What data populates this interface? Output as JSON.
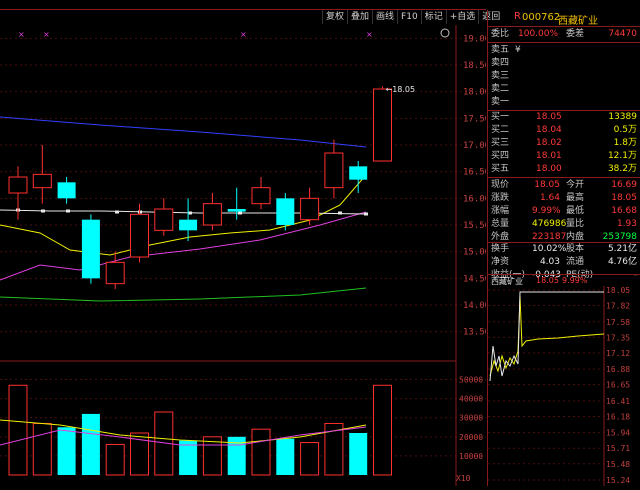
{
  "toolbar": {
    "items": [
      "复权",
      "叠加",
      "画线",
      "F10",
      "标记",
      "+自选",
      "返回"
    ]
  },
  "main_chart": {
    "price_ticks": [
      "18.00",
      "17.50",
      "17.00",
      "16.50",
      "16.00",
      "15.50",
      "15.00",
      "14.50",
      "14.00",
      "13.50",
      "18.50",
      "19.00"
    ],
    "last_price_label": "18.05",
    "volume_ticks": [
      "50000",
      "40000",
      "30000",
      "20000",
      "10000"
    ],
    "volume_unit": "X10",
    "colors": {
      "up": "#ff3030",
      "down": "#00ffff",
      "ma_white": "#e8e8e8",
      "ma_yellow": "#f0f000",
      "ma_purple": "#e040e0",
      "ma_green": "#20c020",
      "ma_blue": "#3040ff"
    },
    "candles": [
      {
        "o": 16.4,
        "c": 16.1,
        "h": 16.6,
        "l": 15.6,
        "up": true
      },
      {
        "o": 16.2,
        "c": 16.45,
        "h": 17.0,
        "l": 15.9,
        "up": true
      },
      {
        "o": 16.3,
        "c": 16.0,
        "h": 16.4,
        "l": 15.9,
        "up": false
      },
      {
        "o": 15.6,
        "c": 14.5,
        "h": 15.7,
        "l": 14.4,
        "up": false
      },
      {
        "o": 14.4,
        "c": 14.8,
        "h": 15.0,
        "l": 14.3,
        "up": true
      },
      {
        "o": 14.9,
        "c": 15.7,
        "h": 15.9,
        "l": 14.8,
        "up": true
      },
      {
        "o": 15.4,
        "c": 15.8,
        "h": 16.0,
        "l": 15.3,
        "up": true
      },
      {
        "o": 15.6,
        "c": 15.4,
        "h": 16.0,
        "l": 15.2,
        "up": false
      },
      {
        "o": 15.5,
        "c": 15.9,
        "h": 16.1,
        "l": 15.4,
        "up": true
      },
      {
        "o": 15.8,
        "c": 15.75,
        "h": 16.2,
        "l": 15.6,
        "up": false
      },
      {
        "o": 15.9,
        "c": 16.2,
        "h": 16.4,
        "l": 15.8,
        "up": true
      },
      {
        "o": 16.0,
        "c": 15.5,
        "h": 16.1,
        "l": 15.4,
        "up": false
      },
      {
        "o": 15.6,
        "c": 16.0,
        "h": 16.2,
        "l": 15.5,
        "up": true
      },
      {
        "o": 16.2,
        "c": 16.85,
        "h": 17.1,
        "l": 16.0,
        "up": true
      },
      {
        "o": 16.6,
        "c": 16.35,
        "h": 16.7,
        "l": 16.1,
        "up": false
      },
      {
        "o": 16.7,
        "c": 18.05,
        "h": 18.1,
        "l": 16.7,
        "up": true
      }
    ],
    "volumes": [
      {
        "v": 47000,
        "up": true
      },
      {
        "v": 27000,
        "up": true
      },
      {
        "v": 25000,
        "up": false
      },
      {
        "v": 32000,
        "up": false
      },
      {
        "v": 16000,
        "up": true
      },
      {
        "v": 22000,
        "up": true
      },
      {
        "v": 33000,
        "up": true
      },
      {
        "v": 18000,
        "up": false
      },
      {
        "v": 20000,
        "up": true
      },
      {
        "v": 20000,
        "up": false
      },
      {
        "v": 24000,
        "up": true
      },
      {
        "v": 19000,
        "up": false
      },
      {
        "v": 17000,
        "up": true
      },
      {
        "v": 27000,
        "up": true
      },
      {
        "v": 22000,
        "up": false
      },
      {
        "v": 47000,
        "up": true
      }
    ]
  },
  "panel": {
    "r_mark": "R",
    "code": "000762",
    "name": "西藏矿业",
    "weibi_label": "委比",
    "weibi_value": "100.00%",
    "weicha_label": "委差",
    "weicha_value": "74470",
    "asks": [
      {
        "label": "卖五",
        "suffix": "¥"
      },
      {
        "label": "卖四"
      },
      {
        "label": "卖三"
      },
      {
        "label": "卖二"
      },
      {
        "label": "卖一"
      }
    ],
    "bids": [
      {
        "label": "买一",
        "price": "18.05",
        "vol": "13389"
      },
      {
        "label": "买二",
        "price": "18.04",
        "vol": "0.5万"
      },
      {
        "label": "买三",
        "price": "18.02",
        "vol": "1.8万"
      },
      {
        "label": "买四",
        "price": "18.01",
        "vol": "12.1万"
      },
      {
        "label": "买五",
        "price": "18.00",
        "vol": "38.2万"
      }
    ],
    "stats": [
      {
        "l1": "现价",
        "v1": "18.05",
        "c1": "red",
        "l2": "今开",
        "v2": "16.69",
        "c2": "red"
      },
      {
        "l1": "涨跌",
        "v1": "1.64",
        "c1": "red",
        "l2": "最高",
        "v2": "18.05",
        "c2": "red"
      },
      {
        "l1": "涨幅",
        "v1": "9.99%",
        "c1": "red",
        "l2": "最低",
        "v2": "16.68",
        "c2": "red"
      },
      {
        "l1": "总量",
        "v1": "476986",
        "c1": "yel",
        "l2": "量比",
        "v2": "1.93",
        "c2": "red"
      },
      {
        "l1": "外盘",
        "v1": "223187",
        "c1": "red",
        "l2": "内盘",
        "v2": "253798",
        "c2": "grn"
      }
    ],
    "stats2": [
      {
        "l1": "换手",
        "v1": "10.02%",
        "c1": "wht",
        "l2": "股本",
        "v2": "5.21亿",
        "c2": "wht"
      },
      {
        "l1": "净资",
        "v1": "4.03",
        "c1": "wht",
        "l2": "流通",
        "v2": "4.76亿",
        "c2": "wht"
      },
      {
        "l1": "收益(一)",
        "v1": "-0.043",
        "c1": "wht",
        "l2": "PE(动)",
        "v2": "-",
        "c2": "wht"
      }
    ],
    "mini_title": "西藏矿业",
    "mini_price": "18.05",
    "mini_pct": "9.99%",
    "mini_ticks": [
      "18.05",
      "17.82",
      "17.58",
      "17.35",
      "17.12",
      "16.88",
      "16.65",
      "16.41",
      "16.18",
      "15.94",
      "15.71",
      "15.48",
      "15.24"
    ]
  }
}
